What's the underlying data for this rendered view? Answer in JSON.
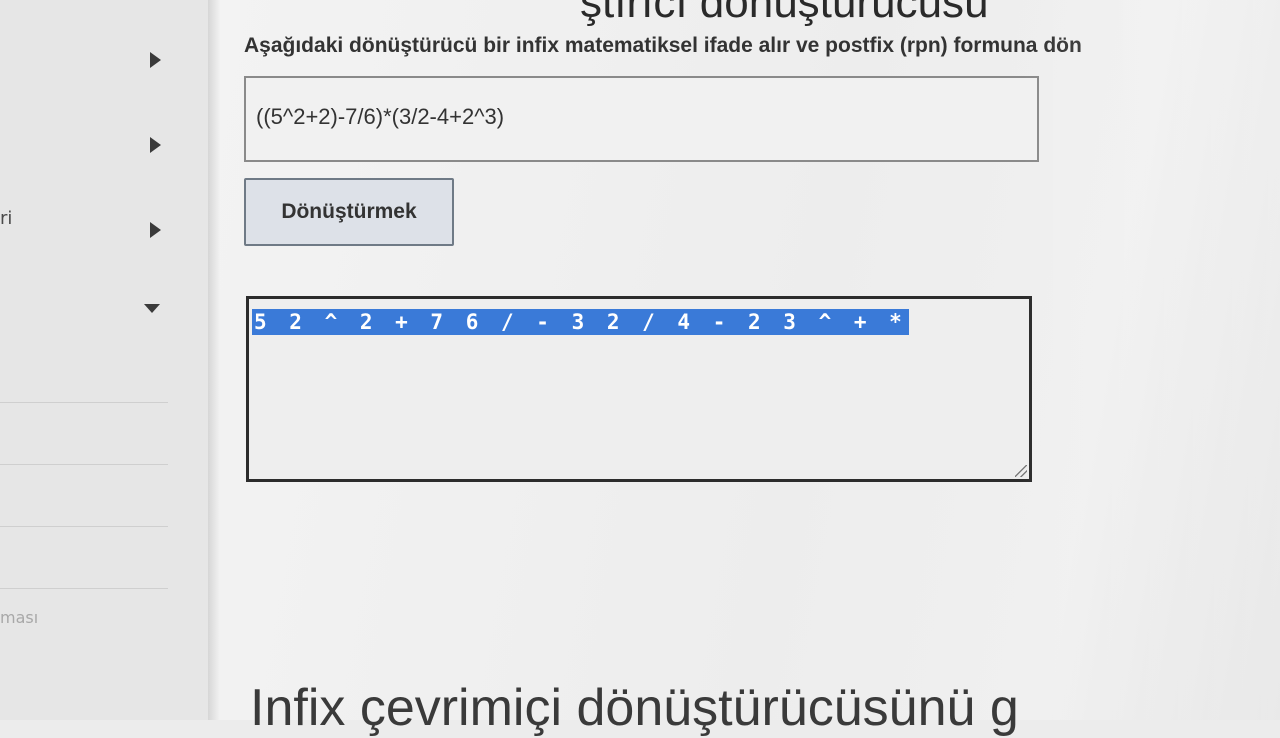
{
  "sidebar": {
    "fragments": {
      "item3": "ri",
      "item_bottom": "ması"
    }
  },
  "main": {
    "top_heading": "ştırıcı dönüştürücüsü",
    "description": "Aşağıdaki dönüştürücü bir infix matematiksel ifade alır ve postfix (rpn) formuna dön",
    "infix_input_value": "((5^2+2)-7/6)*(3/2-4+2^3)",
    "convert_button_label": "Dönüştürmek",
    "output_value": "5 2 ^ 2 + 7 6 / - 3 2 / 4 - 2 3 ^ + *",
    "bottom_heading": "Infix çevrimiçi dönüştürücüsünü g"
  },
  "colors": {
    "selection_highlight": "#3a7ad8",
    "button_background": "#dde1e8"
  }
}
